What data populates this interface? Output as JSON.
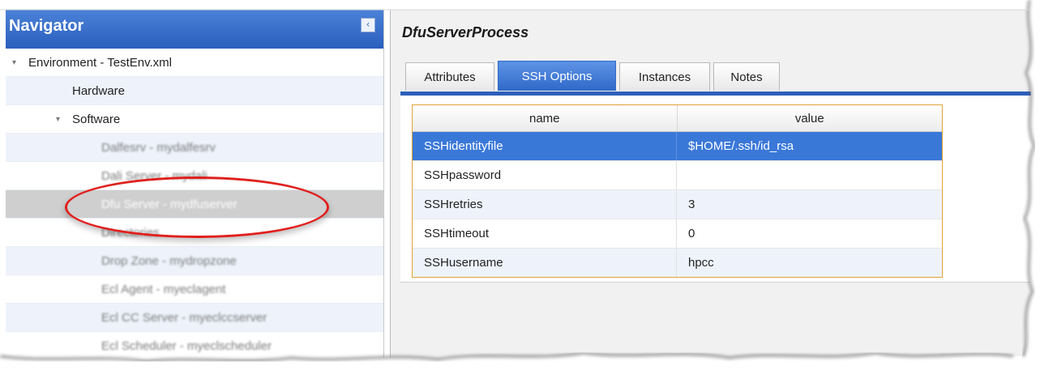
{
  "navigator": {
    "title": "Navigator",
    "collapse_glyph": "‹",
    "items": [
      {
        "label": "Environment - TestEnv.xml",
        "indent": 0,
        "twisty": "expanded",
        "blurred": false
      },
      {
        "label": "Hardware",
        "indent": 1,
        "twisty": "none",
        "blurred": false
      },
      {
        "label": "Software",
        "indent": 1,
        "twisty": "expanded",
        "blurred": false
      },
      {
        "label": "Dalfesrv - mydalfesrv",
        "indent": 2,
        "twisty": "none",
        "blurred": true
      },
      {
        "label": "Dali Server - mydali",
        "indent": 2,
        "twisty": "none",
        "blurred": true
      },
      {
        "label": "Dfu Server - mydfuserver",
        "indent": 2,
        "twisty": "none",
        "blurred": true,
        "selected": true
      },
      {
        "label": "Directories",
        "indent": 2,
        "twisty": "none",
        "blurred": true
      },
      {
        "label": "Drop Zone - mydropzone",
        "indent": 2,
        "twisty": "none",
        "blurred": true
      },
      {
        "label": "Ecl Agent - myeclagent",
        "indent": 2,
        "twisty": "none",
        "blurred": true
      },
      {
        "label": "Ecl CC Server - myeclccserver",
        "indent": 2,
        "twisty": "none",
        "blurred": true
      },
      {
        "label": "Ecl Scheduler - myeclscheduler",
        "indent": 2,
        "twisty": "none",
        "blurred": true
      }
    ]
  },
  "detail": {
    "title": "DfuServerProcess",
    "tabs": [
      {
        "label": "Attributes",
        "active": false
      },
      {
        "label": "SSH Options",
        "active": true
      },
      {
        "label": "Instances",
        "active": false
      },
      {
        "label": "Notes",
        "active": false
      }
    ],
    "table": {
      "columns": [
        "name",
        "value"
      ],
      "rows": [
        {
          "name": "SSHidentityfile",
          "value": "$HOME/.ssh/id_rsa",
          "selected": true
        },
        {
          "name": "SSHpassword",
          "value": ""
        },
        {
          "name": "SSHretries",
          "value": "3"
        },
        {
          "name": "SSHtimeout",
          "value": "0"
        },
        {
          "name": "SSHusername",
          "value": "hpcc"
        }
      ]
    }
  },
  "colors": {
    "header_blue": "#2a5fbd",
    "selection_blue": "#3a78d8",
    "grid_border": "#e2a236",
    "highlight_oval": "#e0201d"
  }
}
